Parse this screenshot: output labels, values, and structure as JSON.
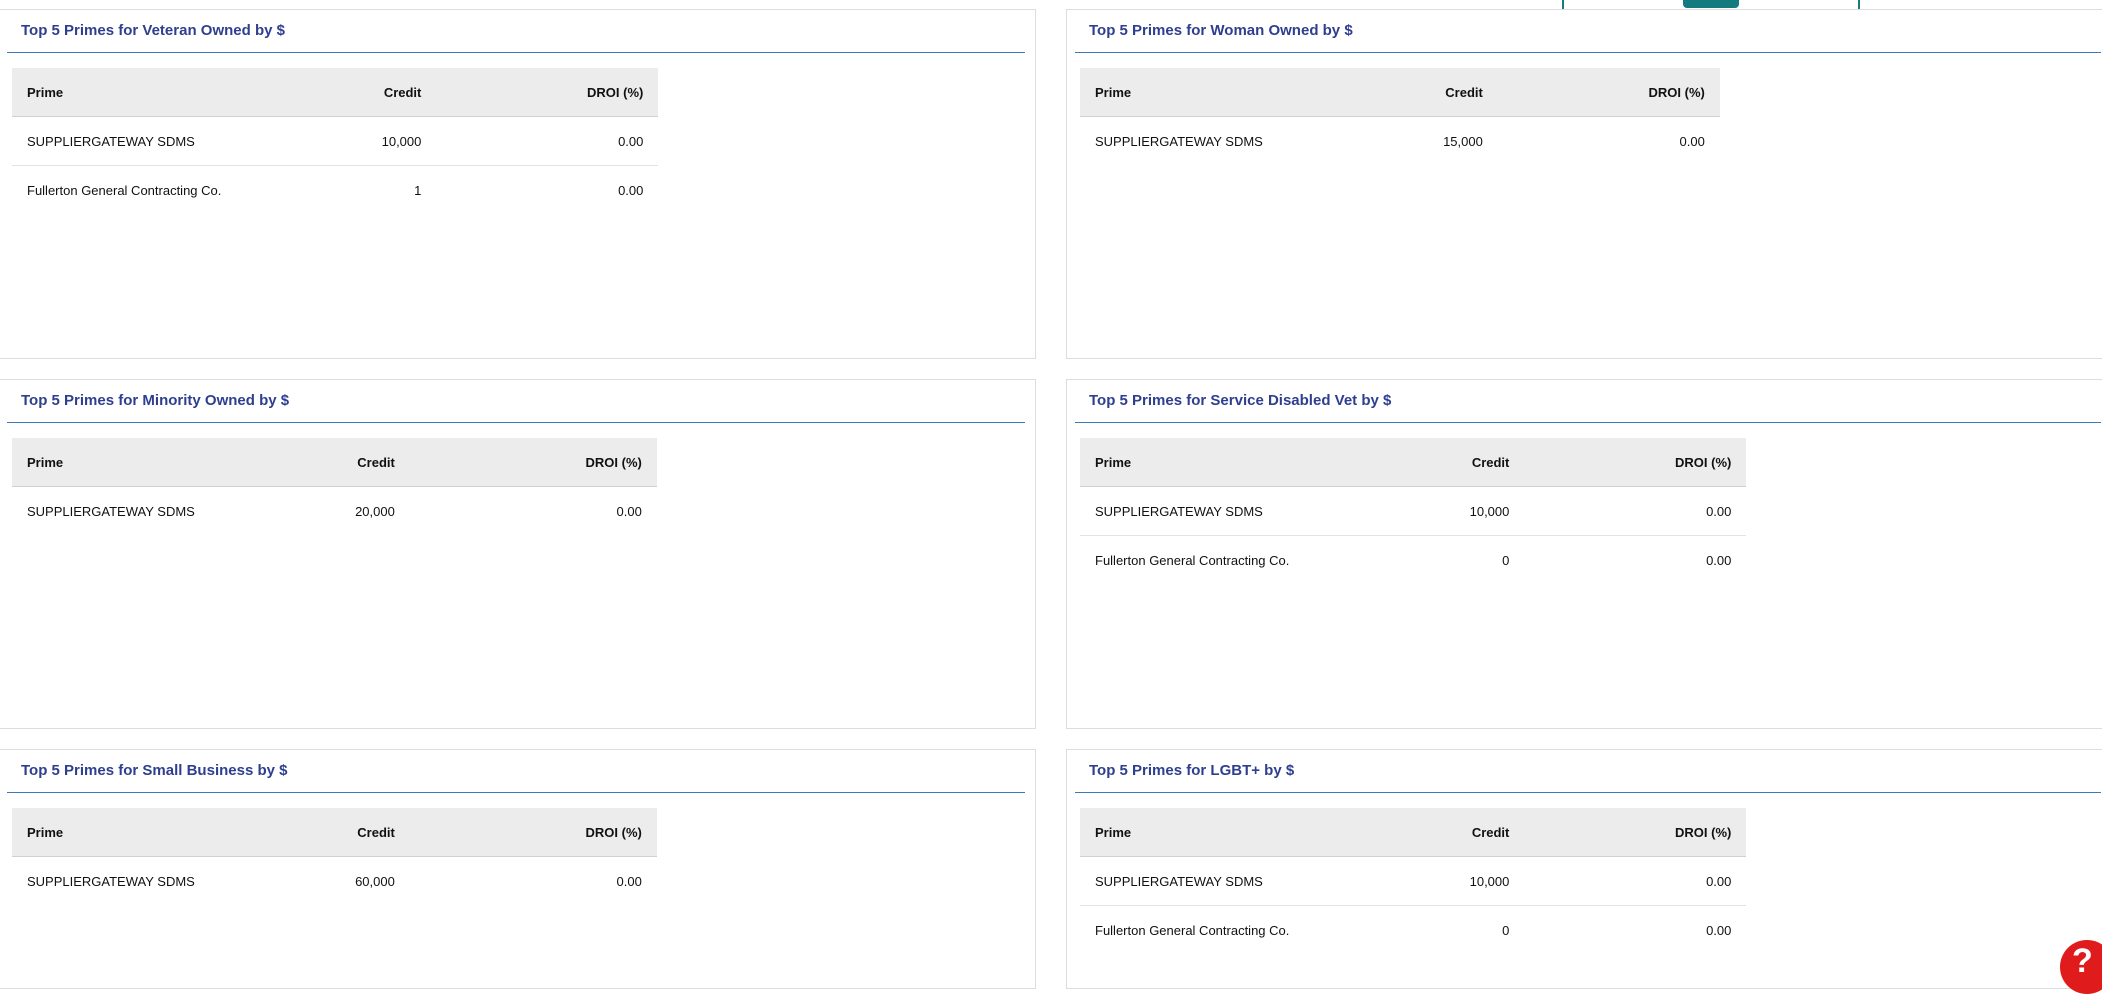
{
  "panels": {
    "veteran": {
      "title": "Top 5 Primes for Veteran Owned by $",
      "columns": {
        "prime": "Prime",
        "credit": "Credit",
        "droi": "DROI (%)"
      },
      "rows": [
        {
          "prime": "SUPPLIERGATEWAY SDMS",
          "credit": "10,000",
          "droi": "0.00"
        },
        {
          "prime": "Fullerton General Contracting Co.",
          "credit": "1",
          "droi": "0.00"
        }
      ]
    },
    "woman": {
      "title": "Top 5 Primes for Woman Owned by $",
      "columns": {
        "prime": "Prime",
        "credit": "Credit",
        "droi": "DROI (%)"
      },
      "rows": [
        {
          "prime": "SUPPLIERGATEWAY SDMS",
          "credit": "15,000",
          "droi": "0.00"
        }
      ]
    },
    "minority": {
      "title": "Top 5 Primes for Minority Owned by $",
      "columns": {
        "prime": "Prime",
        "credit": "Credit",
        "droi": "DROI (%)"
      },
      "rows": [
        {
          "prime": "SUPPLIERGATEWAY SDMS",
          "credit": "20,000",
          "droi": "0.00"
        }
      ]
    },
    "service_disabled": {
      "title": "Top 5 Primes for Service Disabled Vet by $",
      "columns": {
        "prime": "Prime",
        "credit": "Credit",
        "droi": "DROI (%)"
      },
      "rows": [
        {
          "prime": "SUPPLIERGATEWAY SDMS",
          "credit": "10,000",
          "droi": "0.00"
        },
        {
          "prime": "Fullerton General Contracting Co.",
          "credit": "0",
          "droi": "0.00"
        }
      ]
    },
    "small_business": {
      "title": "Top 5 Primes for Small Business by $",
      "columns": {
        "prime": "Prime",
        "credit": "Credit",
        "droi": "DROI (%)"
      },
      "rows": [
        {
          "prime": "SUPPLIERGATEWAY SDMS",
          "credit": "60,000",
          "droi": "0.00"
        }
      ]
    },
    "lgbt": {
      "title": "Top 5 Primes for LGBT+ by $",
      "columns": {
        "prime": "Prime",
        "credit": "Credit",
        "droi": "DROI (%)"
      },
      "rows": [
        {
          "prime": "SUPPLIERGATEWAY SDMS",
          "credit": "10,000",
          "droi": "0.00"
        },
        {
          "prime": "Fullerton General Contracting Co.",
          "credit": "0",
          "droi": "0.00"
        }
      ]
    }
  },
  "help": {
    "glyph": "?",
    "icon": "help-icon",
    "color": "#e01b1b"
  },
  "colors": {
    "title": "#2e3f8f",
    "title_rule": "#3b79b8",
    "header_bg": "#ececec",
    "popup_border": "#1a7a82",
    "popup_button": "#137a80"
  }
}
